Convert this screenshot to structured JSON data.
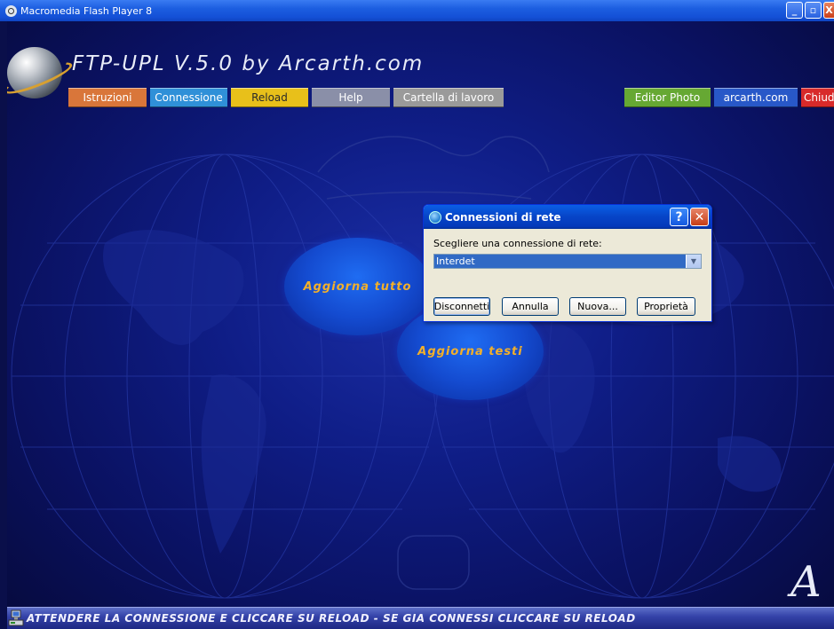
{
  "window": {
    "title": "Macromedia Flash Player 8",
    "minimize_label": "_",
    "maximize_label": "▫",
    "close_label": "X"
  },
  "app": {
    "title": "FTP-UPL V.5.0 by Arcarth.com",
    "nav": [
      {
        "label": "Istruzioni",
        "color": "#d9763a"
      },
      {
        "label": "Connessione",
        "color": "#2f90d8"
      },
      {
        "label": "Reload",
        "color": "#e8c01a"
      },
      {
        "label": "Help",
        "color": "#8a8fa8"
      },
      {
        "label": "Cartella di lavoro",
        "color": "#9a9a9a"
      },
      {
        "label": "Editor Photo",
        "color": "#66a833"
      },
      {
        "label": "arcarth.com",
        "color": "#2858c8"
      },
      {
        "label": "Chiud",
        "color": "#d82a2a"
      }
    ],
    "ovals": {
      "update_all": "Aggiorna tutto",
      "update_texts": "Aggiorna testi"
    }
  },
  "dialog": {
    "title": "Connessioni di rete",
    "help_label": "?",
    "close_label": "✕",
    "prompt": "Scegliere una connessione di rete:",
    "selected_connection": "Interdet",
    "buttons": {
      "disconnect": "Disconnetti",
      "cancel": "Annulla",
      "new": "Nuova...",
      "properties": "Proprietà"
    }
  },
  "status": {
    "message": "ATTENDERE LA CONNESSIONE E CLICCARE SU RELOAD - SE GIA CONNESSI CLICCARE SU RELOAD"
  }
}
